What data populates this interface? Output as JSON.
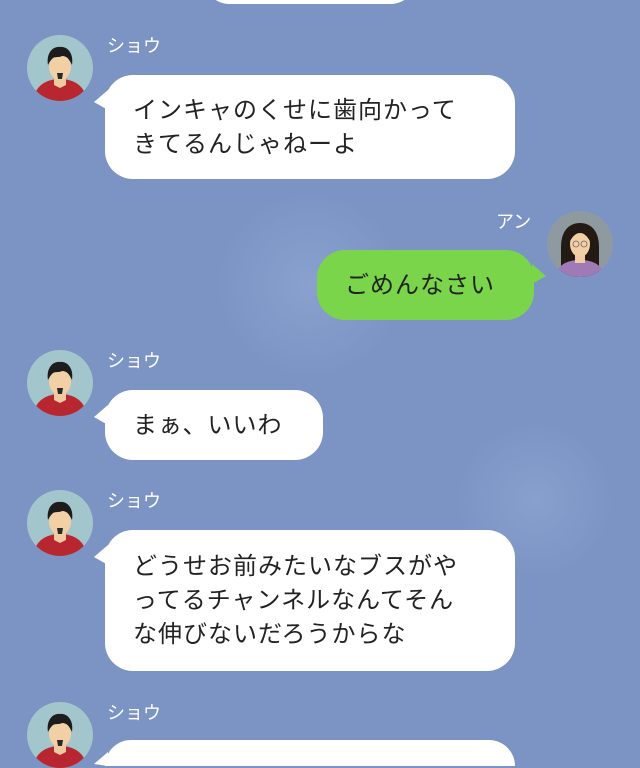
{
  "messages": [
    {
      "sender": "ショウ",
      "side": "left",
      "text": "インキャのくせに歯向かって\nきてるんじゃねーよ"
    },
    {
      "sender": "アン",
      "side": "right",
      "text": "ごめんなさい"
    },
    {
      "sender": "ショウ",
      "side": "left",
      "text": "まぁ、いいわ"
    },
    {
      "sender": "ショウ",
      "side": "left",
      "text": "どうせお前みたいなブスがや\nってるチャンネルなんてそん\nな伸びないだろうからな"
    },
    {
      "sender": "ショウ",
      "side": "left",
      "text": ""
    }
  ],
  "colors": {
    "background": "#7b94c4",
    "bubble_received": "#ffffff",
    "bubble_sent": "#7ad54a"
  }
}
